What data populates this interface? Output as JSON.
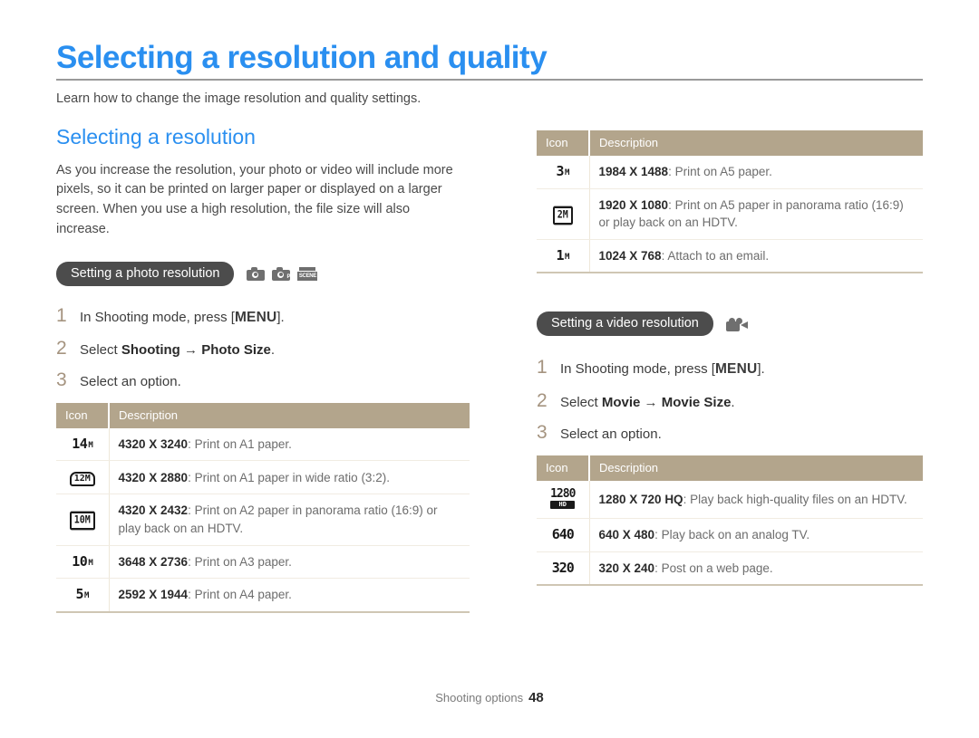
{
  "header": {
    "title": "Selecting a resolution and quality",
    "subtitle": "Learn how to change the image resolution and quality settings.",
    "accent_color": "#2a8ff0",
    "rule_color": "#9a9a9a"
  },
  "left_column": {
    "section_title": "Selecting a resolution",
    "body": "As you increase the resolution, your photo or video will include more pixels, so it can be printed on larger paper or displayed on a larger screen. When you use a high resolution, the file size will also increase.",
    "pill": {
      "label": "Setting a photo resolution",
      "background": "#4c4c4c",
      "mode_icons": [
        {
          "name": "smart-auto-icon",
          "tag": "SMART"
        },
        {
          "name": "program-mode-icon",
          "tag": "P"
        },
        {
          "name": "scene-mode-icon",
          "tag": "SCENE"
        }
      ]
    },
    "steps": [
      {
        "num": "1",
        "pre": "In Shooting mode, press [",
        "kbd": "MENU",
        "post": "]."
      },
      {
        "num": "2",
        "pre": "Select ",
        "bold1": "Shooting",
        "arrow": " → ",
        "bold2": "Photo Size",
        "post": "."
      },
      {
        "num": "3",
        "pre": "Select an option.",
        "kbd": "",
        "post": ""
      }
    ],
    "table": {
      "headers": [
        "Icon",
        "Description"
      ],
      "header_bg": "#b3a58c",
      "rows": [
        {
          "icon_style": "lcd",
          "icon_num": "14",
          "icon_suffix": "M",
          "resolution": "4320 X 3240",
          "desc": ": Print on A1 paper."
        },
        {
          "icon_style": "wide",
          "icon_num": "12M",
          "icon_suffix": "",
          "resolution": "4320 X 2880",
          "desc": ": Print on A1 paper in wide ratio (3:2)."
        },
        {
          "icon_style": "pano",
          "icon_num": "10M",
          "icon_suffix": "",
          "resolution": "4320 X 2432",
          "desc": ": Print on A2 paper in panorama ratio (16:9) or play back on an HDTV."
        },
        {
          "icon_style": "lcd",
          "icon_num": "10",
          "icon_suffix": "M",
          "resolution": "3648 X 2736",
          "desc": ": Print on A3 paper."
        },
        {
          "icon_style": "lcd",
          "icon_num": "5",
          "icon_suffix": "M",
          "resolution": "2592 X 1944",
          "desc": ": Print on A4 paper."
        }
      ]
    }
  },
  "right_column": {
    "table_top": {
      "headers": [
        "Icon",
        "Description"
      ],
      "header_bg": "#b3a58c",
      "rows": [
        {
          "icon_style": "lcd",
          "icon_num": "3",
          "icon_suffix": "M",
          "resolution": "1984 X 1488",
          "desc": ": Print on A5 paper."
        },
        {
          "icon_style": "pano",
          "icon_num": "2M",
          "icon_suffix": "",
          "resolution": "1920 X 1080",
          "desc": ": Print on A5 paper in panorama ratio (16:9) or play back on an HDTV."
        },
        {
          "icon_style": "lcd",
          "icon_num": "1",
          "icon_suffix": "M",
          "resolution": "1024 X 768",
          "desc": ": Attach to an email."
        }
      ]
    },
    "pill": {
      "label": "Setting a video resolution",
      "background": "#4c4c4c",
      "mode_icons": [
        {
          "name": "movie-mode-icon",
          "tag": ""
        }
      ]
    },
    "steps": [
      {
        "num": "1",
        "pre": "In Shooting mode, press [",
        "kbd": "MENU",
        "post": "]."
      },
      {
        "num": "2",
        "pre": "Select ",
        "bold1": "Movie",
        "arrow": " → ",
        "bold2": "Movie Size",
        "post": "."
      },
      {
        "num": "3",
        "pre": "Select an option.",
        "kbd": "",
        "post": ""
      }
    ],
    "table_bottom": {
      "headers": [
        "Icon",
        "Description"
      ],
      "header_bg": "#b3a58c",
      "rows": [
        {
          "icon_style": "hd",
          "icon_num": "1280",
          "icon_suffix": "HD",
          "resolution": "1280 X 720 HQ",
          "desc": ": Play back high-quality files on an HDTV."
        },
        {
          "icon_style": "plain",
          "icon_num": "640",
          "icon_suffix": "",
          "resolution": "640 X 480",
          "desc": ": Play back on an analog TV."
        },
        {
          "icon_style": "plain",
          "icon_num": "320",
          "icon_suffix": "",
          "resolution": "320 X 240",
          "desc": ": Post on a web page."
        }
      ]
    }
  },
  "footer": {
    "section": "Shooting options",
    "page_number": "48"
  }
}
